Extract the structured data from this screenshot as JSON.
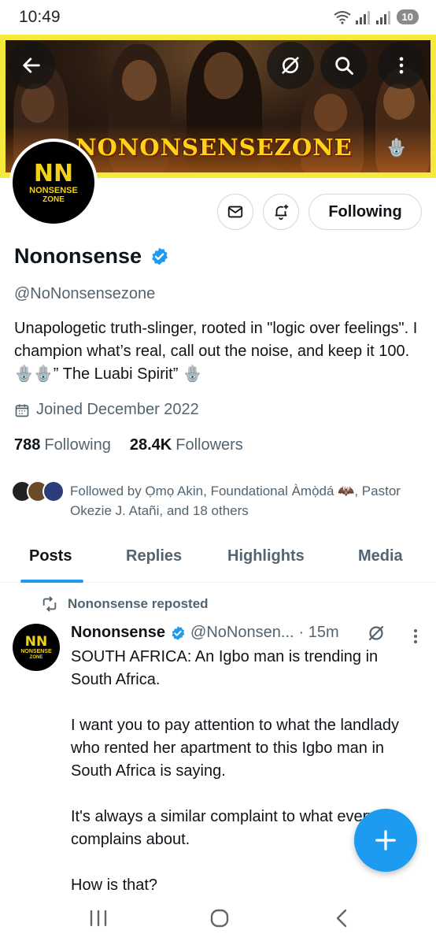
{
  "status_bar": {
    "time": "10:49",
    "battery": "10"
  },
  "banner": {
    "title": "NONONSENSEZONE",
    "hand_emoji": "🪬"
  },
  "top_actions": {
    "back_icon": "back-arrow-icon",
    "grok_icon": "grok-icon",
    "search_icon": "search-icon",
    "more_icon": "more-vertical-icon"
  },
  "avatar": {
    "line1": "NN",
    "line2": "NONSENSE",
    "line3": "ZONE"
  },
  "profile": {
    "follow_button": "Following",
    "display_name": "Nononsense",
    "handle": "@NoNonsensezone",
    "bio": "Unapologetic truth-slinger, rooted in \"logic over feelings\". I champion what’s real, call out the noise, and keep it 100. 🪬🪬” The  Luabi  Spirit”  🪬",
    "joined": "Joined December 2022",
    "following_count": "788",
    "following_label": "Following",
    "followers_count": "28.4K",
    "followers_label": "Followers",
    "followed_by": "Followed by Ọmọ Akin, Foundational Àmọ̀dá 🦇, Pastor Okezie J. Atañi, and 18 others"
  },
  "tabs": [
    {
      "label": "Posts"
    },
    {
      "label": "Replies"
    },
    {
      "label": "Highlights"
    },
    {
      "label": "Media"
    }
  ],
  "post": {
    "repost_label": "Nononsense reposted",
    "author_name": "Nononsense",
    "author_handle": "@NoNonsen...",
    "time": "· 15m",
    "text": "SOUTH AFRICA: An Igbo man is trending in South Africa.\n\nI want you to pay attention to what the landlady who rented her apartment to this Igbo man in South Africa is saying.\n\nIt's always a similar complaint to what everyone complains about.\n\nHow is that?"
  },
  "colors": {
    "accent": "#1d9bf0",
    "banner_frame": "#f5ea3c",
    "logo_yellow": "#f1d21a",
    "secondary_text": "#536471"
  }
}
